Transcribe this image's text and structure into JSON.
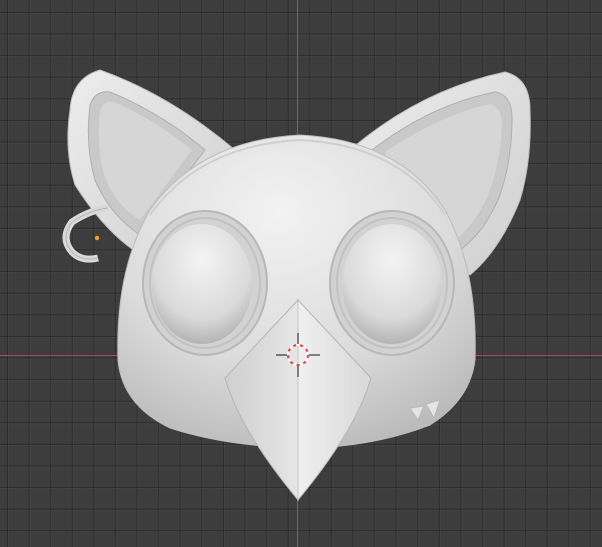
{
  "viewport": {
    "grid_color": "#4a4a4a",
    "background_color": "#3d3d3d",
    "x_axis_color": "#a64a55",
    "y_axis_color": "#4d6f9c"
  },
  "model": {
    "material_color": "#e2e2e2",
    "selection_color": "#e8a23a",
    "parts": [
      "head",
      "left-ear",
      "right-ear",
      "left-eye",
      "right-eye",
      "beak",
      "earring",
      "teeth"
    ]
  },
  "cursor": {
    "icon": "3d-cursor-icon",
    "color": "#e0404a"
  }
}
